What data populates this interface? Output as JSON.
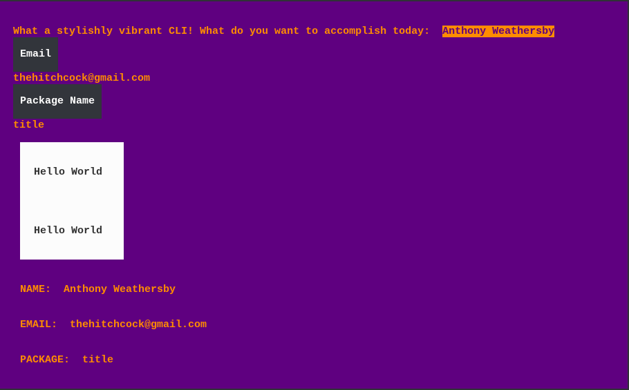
{
  "prompt": {
    "question": "What a stylishly vibrant CLI! What do you want to accomplish today:  ",
    "answer": "Anthony Weathersby"
  },
  "fields": {
    "email_label": "Email",
    "email_value": "thehitchcock@gmail.com",
    "package_label": "Package Name",
    "package_value": "title"
  },
  "card": {
    "lines": [
      "Hello World",
      "Hello World"
    ]
  },
  "summary": {
    "name_label": "NAME:  ",
    "name_value": "Anthony Weathersby",
    "email_label": "EMAIL:  ",
    "email_value": "thehitchcock@gmail.com",
    "package_label": "PACKAGE:  ",
    "package_value": "title"
  },
  "colors": {
    "background": "#5f0080",
    "accent": "#ff8c00",
    "label_bg": "#32353b",
    "card_bg": "#fcfcfc"
  }
}
